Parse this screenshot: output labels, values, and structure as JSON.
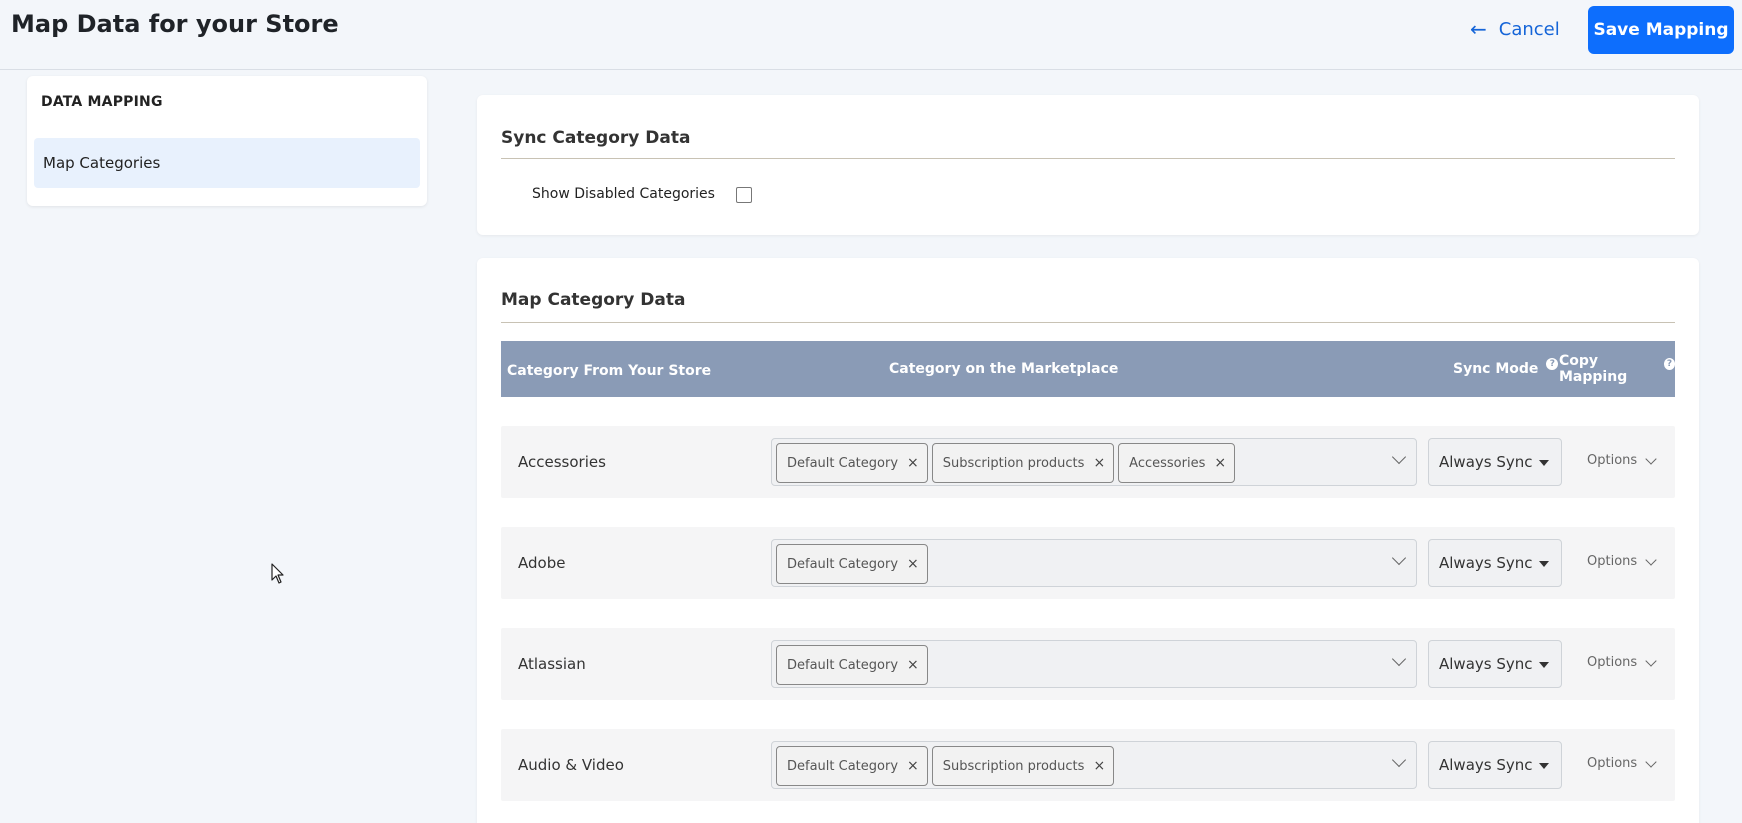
{
  "header": {
    "title": "Map Data for your Store",
    "cancel_label": "Cancel",
    "save_label": "Save Mapping",
    "cancel_icon": "arrow-left-icon"
  },
  "sidebar": {
    "heading": "DATA MAPPING",
    "items": [
      {
        "label": "Map Categories",
        "active": true
      }
    ]
  },
  "sync_card": {
    "title": "Sync Category Data",
    "show_disabled_label": "Show Disabled Categories",
    "show_disabled_checked": false
  },
  "map_card": {
    "title": "Map Category Data",
    "columns": {
      "store": "Category From Your Store",
      "marketplace": "Category on the Marketplace",
      "sync_mode": "Sync Mode",
      "copy_mapping": "Copy Mapping"
    },
    "rows": [
      {
        "name": "Accessories",
        "tags": [
          "Default Category",
          "Subscription products",
          "Accessories"
        ],
        "sync_mode": "Always Sync",
        "options_label": "Options"
      },
      {
        "name": "Adobe",
        "tags": [
          "Default Category"
        ],
        "sync_mode": "Always Sync",
        "options_label": "Options"
      },
      {
        "name": "Atlassian",
        "tags": [
          "Default Category"
        ],
        "sync_mode": "Always Sync",
        "options_label": "Options"
      },
      {
        "name": "Audio & Video",
        "tags": [
          "Default Category",
          "Subscription products"
        ],
        "sync_mode": "Always Sync",
        "options_label": "Options"
      }
    ]
  },
  "colors": {
    "primary": "#0d6efd",
    "table_header": "#8a9bb6",
    "sidebar_active": "#e8f1fd"
  }
}
